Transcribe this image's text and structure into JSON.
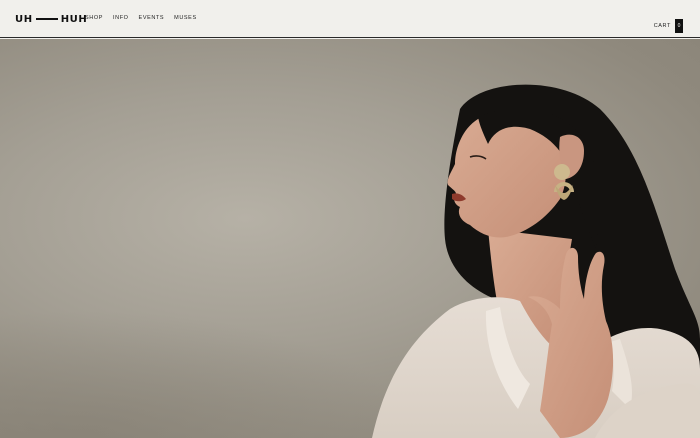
{
  "header": {
    "logo_left": "UH",
    "logo_right": "HUH",
    "nav": [
      {
        "label": "SHOP"
      },
      {
        "label": "INFO"
      },
      {
        "label": "EVENTS"
      },
      {
        "label": "MUSES"
      }
    ],
    "cart_label": "CART",
    "cart_count": "0"
  },
  "hero": {
    "image": "woman-with-gold-earrings-photo"
  }
}
